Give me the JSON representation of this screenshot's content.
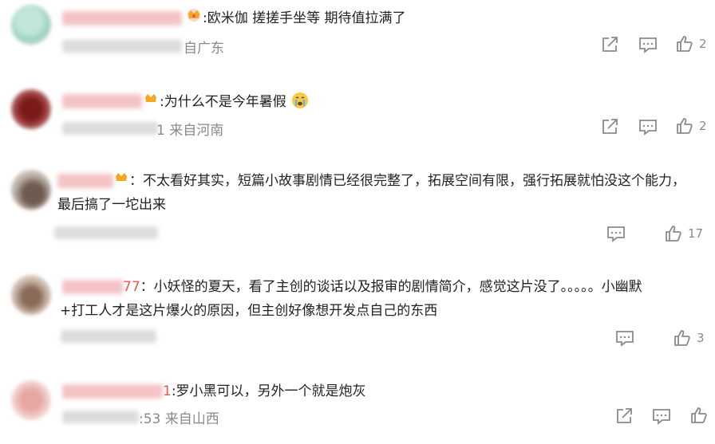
{
  "icons": {
    "share": "share-icon",
    "reply": "comment-icon",
    "like": "thumbs-up-icon",
    "badge": "crown-badge-icon"
  },
  "colors": {
    "text": "#222222",
    "meta": "#8a8a8a",
    "name_pink": "#f4b4b8",
    "badge_gold": "#f5a623",
    "red_digits": "#e8584f"
  },
  "comments": [
    {
      "name_tail": "",
      "text": ":欧米伽 搓搓手坐等 期待值拉满了",
      "text2": "",
      "meta_tail": "自广东",
      "likes": "2"
    },
    {
      "name_tail": "",
      "text": ":为什么不是今年暑假",
      "text2": "",
      "meta_tail": "1 来自河南",
      "likes": "2"
    },
    {
      "name_tail": "",
      "text": "：不太看好其实，短篇小故事剧情已经很完整了，拓展空间有限，强行拓展就怕没这个能力，",
      "text2": "最后搞了一坨出来",
      "meta_tail": "",
      "likes": "17"
    },
    {
      "name_tail": "77",
      "text": "：小妖怪的夏天，看了主创的谈话以及报审的剧情简介，感觉这片没了。。。。。小幽默",
      "text2": "+打工人才是这片爆火的原因，但主创好像想开发点自己的东西",
      "meta_tail": "",
      "likes": "3"
    },
    {
      "name_tail": "1",
      "text": ":罗小黑可以，另外一个就是炮灰",
      "text2": "",
      "meta_tail": ":53 来自山西",
      "likes": ""
    }
  ]
}
